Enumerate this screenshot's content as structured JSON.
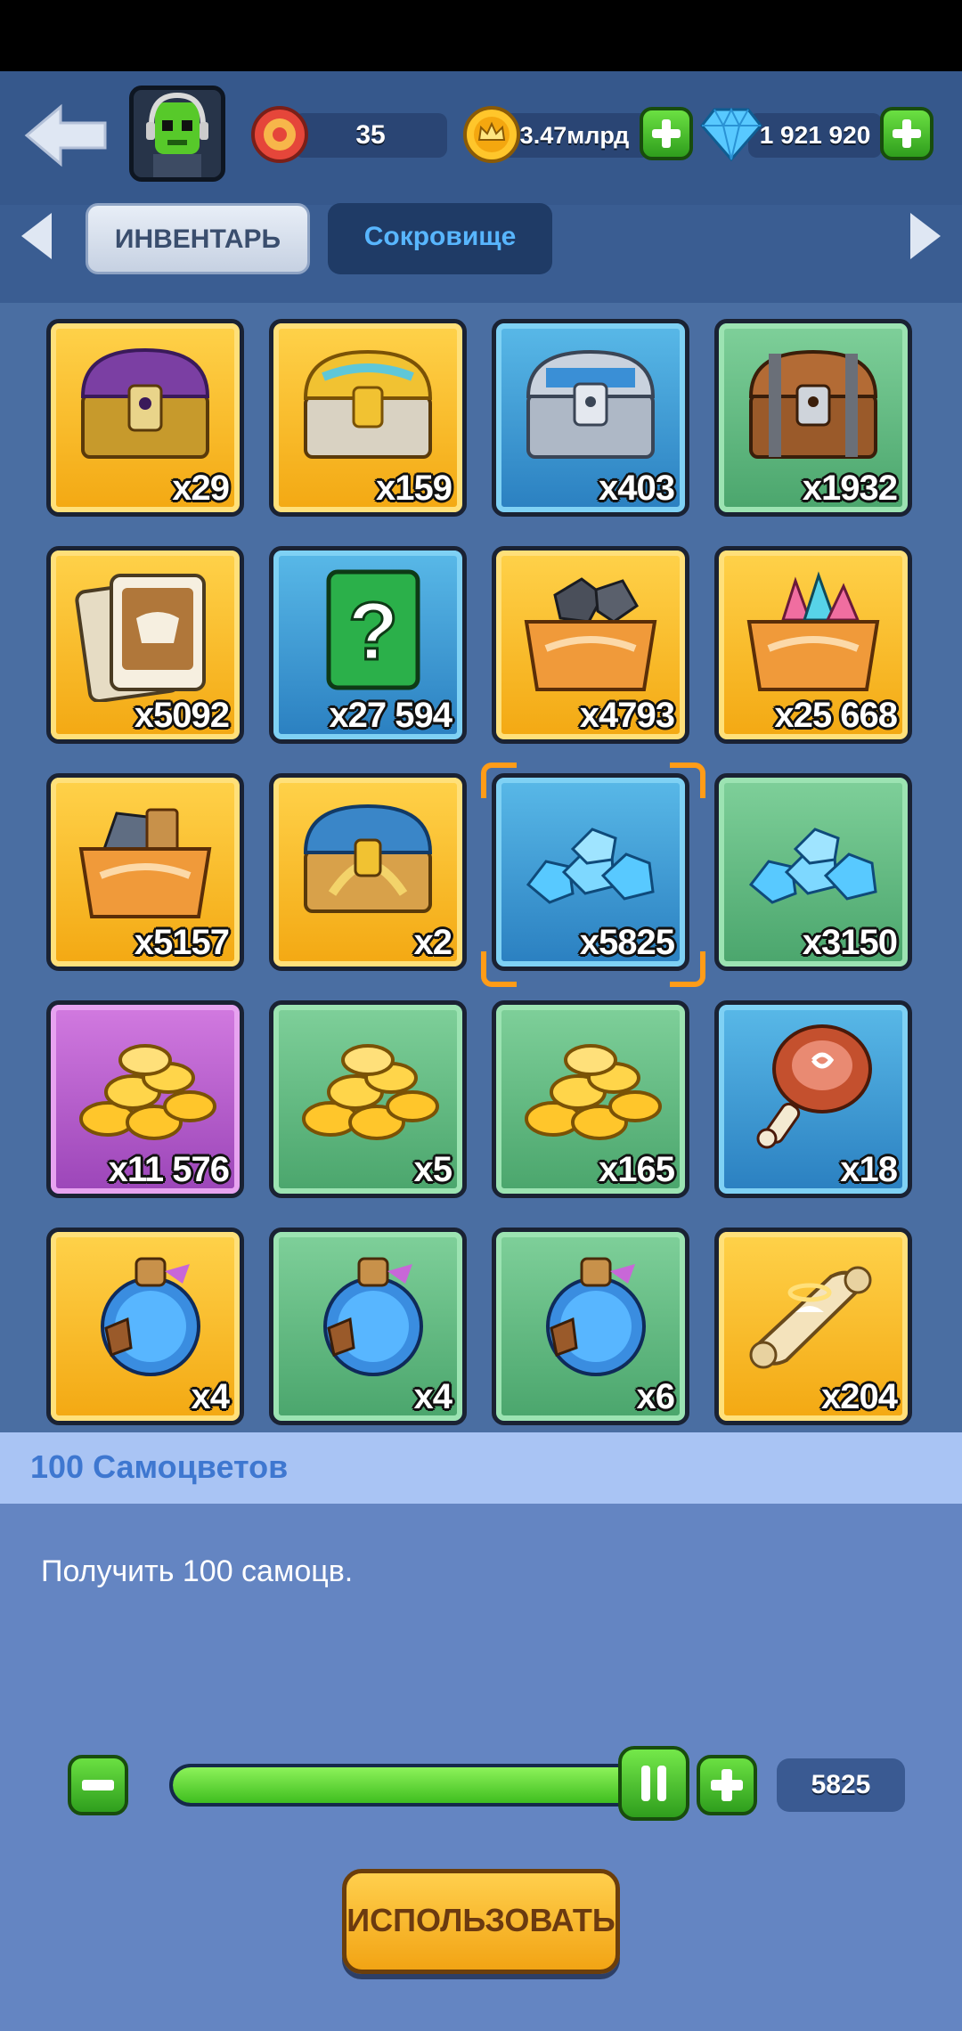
{
  "header": {
    "level": "35",
    "gold": "3.47млрд",
    "gems": "1 921 920"
  },
  "tabs": [
    {
      "label": "ИНВЕНТАРЬ",
      "active": true
    },
    {
      "label": "Сокровище",
      "active": false
    }
  ],
  "items": [
    {
      "icon": "purple-chest-icon",
      "qty": "x29",
      "bg": "gold"
    },
    {
      "icon": "golden-chest-icon",
      "qty": "x159",
      "bg": "gold"
    },
    {
      "icon": "silver-chest-icon",
      "qty": "x403",
      "bg": "blue"
    },
    {
      "icon": "wooden-chest-icon",
      "qty": "x1932",
      "bg": "green"
    },
    {
      "icon": "hero-card-icon",
      "qty": "x5092",
      "bg": "gold"
    },
    {
      "icon": "mystery-box-icon",
      "qty": "x27 594",
      "bg": "blue"
    },
    {
      "icon": "dark-ore-crate-icon",
      "qty": "x4793",
      "bg": "gold"
    },
    {
      "icon": "pink-crystal-crate-icon",
      "qty": "x25 668",
      "bg": "gold"
    },
    {
      "icon": "stone-wood-crate-icon",
      "qty": "x5157",
      "bg": "gold"
    },
    {
      "icon": "laurel-chest-icon",
      "qty": "x2",
      "bg": "gold"
    },
    {
      "icon": "gems-pile-icon",
      "qty": "x5825",
      "bg": "blue",
      "selected": true
    },
    {
      "icon": "gems-pile-icon",
      "qty": "x3150",
      "bg": "green"
    },
    {
      "icon": "gold-coins-icon",
      "qty": "x11 576",
      "bg": "purple"
    },
    {
      "icon": "gold-coins-icon",
      "qty": "x5",
      "bg": "green"
    },
    {
      "icon": "gold-coins-icon",
      "qty": "x165",
      "bg": "green"
    },
    {
      "icon": "meat-icon",
      "qty": "x18",
      "bg": "blue"
    },
    {
      "icon": "potion-icon",
      "qty": "x4",
      "bg": "gold"
    },
    {
      "icon": "potion-icon",
      "qty": "x4",
      "bg": "green"
    },
    {
      "icon": "potion-icon",
      "qty": "x6",
      "bg": "green"
    },
    {
      "icon": "scroll-icon",
      "qty": "x204",
      "bg": "gold"
    }
  ],
  "detail": {
    "title": "100 Самоцветов",
    "description": "Получить 100 самоцв.",
    "slider_fraction": 1.0,
    "quantity": "5825",
    "use_label": "ИСПОЛЬЗОВАТЬ"
  },
  "colors": {
    "accent_green": "#3fbe1f",
    "selection_orange": "#ff9c18",
    "use_button": "#f2a414"
  }
}
